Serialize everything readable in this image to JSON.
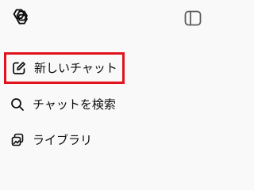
{
  "sidebar": {
    "items": [
      {
        "icon": "edit-icon",
        "label": "新しいチャット",
        "highlighted": true,
        "highlight_color": "#e0131c"
      },
      {
        "icon": "search-icon",
        "label": "チャットを検索"
      },
      {
        "icon": "library-icon",
        "label": "ライブラリ"
      }
    ]
  }
}
